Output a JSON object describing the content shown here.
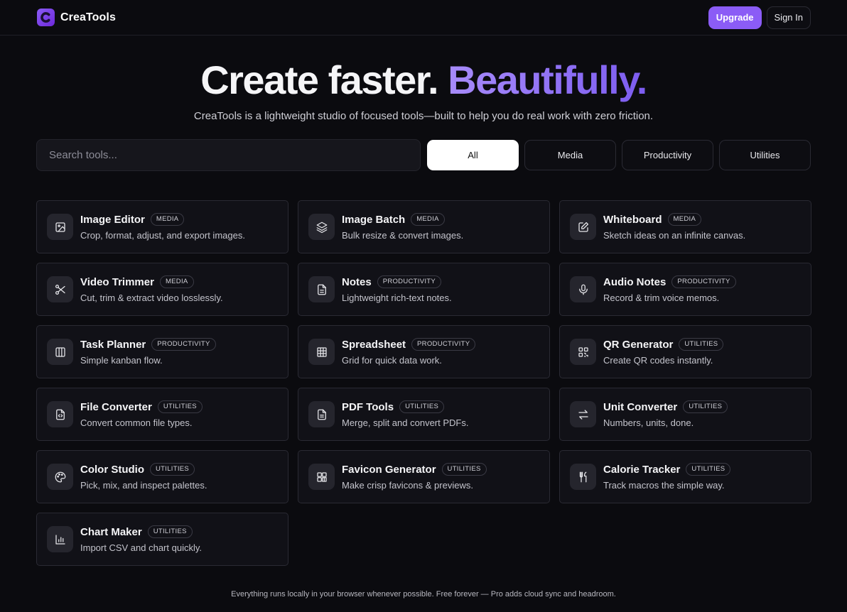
{
  "header": {
    "brand": "CreaTools",
    "upgrade_label": "Upgrade",
    "signin_label": "Sign In"
  },
  "hero": {
    "title_main": "Create faster.",
    "title_accent": "Beautifully.",
    "subtitle": "CreaTools is a lightweight studio of focused tools—built to help you do real work with zero friction."
  },
  "search": {
    "placeholder": "Search tools..."
  },
  "filters": [
    {
      "label": "All",
      "active": true
    },
    {
      "label": "Media",
      "active": false
    },
    {
      "label": "Productivity",
      "active": false
    },
    {
      "label": "Utilities",
      "active": false
    }
  ],
  "tools": [
    {
      "title": "Image Editor",
      "badge": "MEDIA",
      "desc": "Crop, format, adjust, and export images.",
      "icon": "image-icon"
    },
    {
      "title": "Image Batch",
      "badge": "MEDIA",
      "desc": "Bulk resize & convert images.",
      "icon": "layers-icon"
    },
    {
      "title": "Whiteboard",
      "badge": "MEDIA",
      "desc": "Sketch ideas on an infinite canvas.",
      "icon": "edit-square-icon"
    },
    {
      "title": "Video Trimmer",
      "badge": "MEDIA",
      "desc": "Cut, trim & extract video losslessly.",
      "icon": "scissors-icon"
    },
    {
      "title": "Notes",
      "badge": "PRODUCTIVITY",
      "desc": "Lightweight rich-text notes.",
      "icon": "document-icon"
    },
    {
      "title": "Audio Notes",
      "badge": "PRODUCTIVITY",
      "desc": "Record & trim voice memos.",
      "icon": "microphone-icon"
    },
    {
      "title": "Task Planner",
      "badge": "PRODUCTIVITY",
      "desc": "Simple kanban flow.",
      "icon": "columns-icon"
    },
    {
      "title": "Spreadsheet",
      "badge": "PRODUCTIVITY",
      "desc": "Grid for quick data work.",
      "icon": "table-icon"
    },
    {
      "title": "QR Generator",
      "badge": "UTILITIES",
      "desc": "Create QR codes instantly.",
      "icon": "qr-code-icon"
    },
    {
      "title": "File Converter",
      "badge": "UTILITIES",
      "desc": "Convert common file types.",
      "icon": "file-code-icon"
    },
    {
      "title": "PDF Tools",
      "badge": "UTILITIES",
      "desc": "Merge, split and convert PDFs.",
      "icon": "file-text-icon"
    },
    {
      "title": "Unit Converter",
      "badge": "UTILITIES",
      "desc": "Numbers, units, done.",
      "icon": "arrows-swap-icon"
    },
    {
      "title": "Color Studio",
      "badge": "UTILITIES",
      "desc": "Pick, mix, and inspect palettes.",
      "icon": "palette-icon"
    },
    {
      "title": "Favicon Generator",
      "badge": "UTILITIES",
      "desc": "Make crisp favicons & previews.",
      "icon": "favicon-grid-icon"
    },
    {
      "title": "Calorie Tracker",
      "badge": "UTILITIES",
      "desc": "Track macros the simple way.",
      "icon": "utensils-icon"
    },
    {
      "title": "Chart Maker",
      "badge": "UTILITIES",
      "desc": "Import CSV and chart quickly.",
      "icon": "bar-chart-icon"
    }
  ],
  "footer": {
    "text": "Everything runs locally in your browser whenever possible. Free forever — Pro adds cloud sync and headroom."
  },
  "colors": {
    "accent": "#8b5cf6",
    "background": "#0b0b0f",
    "card": "#111117"
  }
}
